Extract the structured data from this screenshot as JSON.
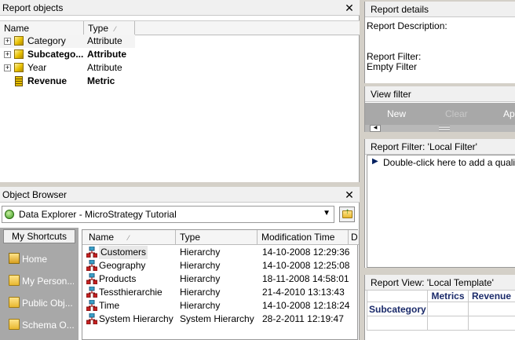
{
  "report_objects": {
    "title": "Report objects",
    "columns": {
      "name": "Name",
      "type": "Type"
    },
    "rows": [
      {
        "name": "Category",
        "type": "Attribute",
        "bold": false,
        "icon": "attribute-cube-icon",
        "expandable": true
      },
      {
        "name": "Subcatego...",
        "type": "Attribute",
        "bold": true,
        "icon": "attribute-cube-icon",
        "expandable": true
      },
      {
        "name": "Year",
        "type": "Attribute",
        "bold": false,
        "icon": "attribute-cube-icon",
        "expandable": true
      },
      {
        "name": "Revenue",
        "type": "Metric",
        "bold": true,
        "icon": "metric-icon",
        "expandable": false
      }
    ]
  },
  "object_browser": {
    "title": "Object Browser",
    "location": "Data Explorer - MicroStrategy Tutorial",
    "shortcuts_tab": "My Shortcuts",
    "shortcuts": [
      {
        "label": "Home",
        "icon": "home-icon"
      },
      {
        "label": "My Person...",
        "icon": "person-folder-icon"
      },
      {
        "label": "Public Obj...",
        "icon": "folder-icon"
      },
      {
        "label": "Schema O...",
        "icon": "folder-icon"
      }
    ],
    "columns": {
      "name": "Name",
      "type": "Type",
      "modified": "Modification Time",
      "extra": "D"
    },
    "rows": [
      {
        "name": "Customers",
        "type": "Hierarchy",
        "modified": "14-10-2008 12:29:36"
      },
      {
        "name": "Geography",
        "type": "Hierarchy",
        "modified": "14-10-2008 12:25:08"
      },
      {
        "name": "Products",
        "type": "Hierarchy",
        "modified": "18-11-2008 14:58:01"
      },
      {
        "name": "Tessthierarchie",
        "type": "Hierarchy",
        "modified": "21-4-2010 13:13:43"
      },
      {
        "name": "Time",
        "type": "Hierarchy",
        "modified": "14-10-2008 12:18:24"
      },
      {
        "name": "System Hierarchy",
        "type": "System Hierarchy",
        "modified": "28-2-2011 12:19:47"
      }
    ]
  },
  "report_details": {
    "title": "Report details",
    "description_label": "Report Description:",
    "filter_label": "Report Filter:",
    "filter_value": "Empty Filter"
  },
  "view_filter": {
    "title": "View filter",
    "buttons": {
      "new": "New",
      "clear": "Clear",
      "apply": "App"
    }
  },
  "report_filter": {
    "title": "Report Filter: 'Local Filter'",
    "hint": "Double-click here to add a quali"
  },
  "report_view": {
    "title": "Report View: 'Local Template'",
    "metrics_header": "Metrics",
    "revenue_header": "Revenue",
    "row_header": "Subcategory"
  }
}
